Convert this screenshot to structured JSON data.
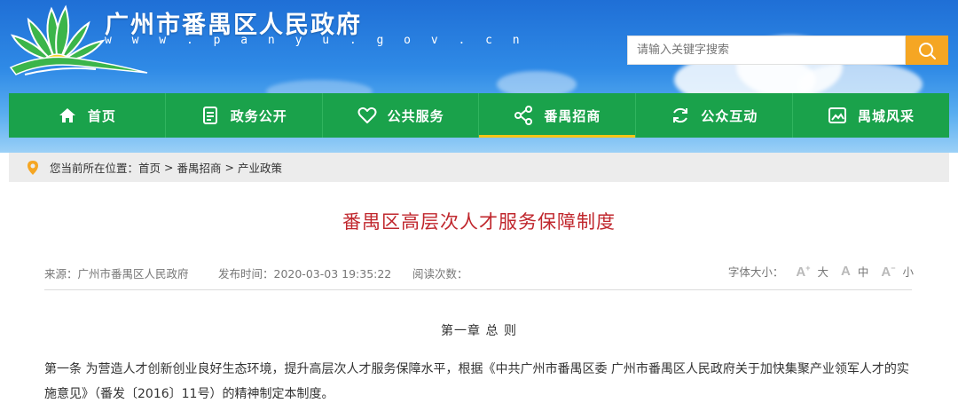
{
  "header": {
    "site_title": "广州市番禺区人民政府",
    "site_url": "w w w . p a n y u . g o v . c n",
    "search_placeholder": "请输入关键字搜索",
    "logo_icon": "lotus-logo-icon",
    "search_icon": "search-icon"
  },
  "nav": {
    "items": [
      {
        "label": "首页",
        "icon": "home-icon"
      },
      {
        "label": "政务公开",
        "icon": "document-icon"
      },
      {
        "label": "公共服务",
        "icon": "heart-icon"
      },
      {
        "label": "番禺招商",
        "icon": "share-icon",
        "active": true
      },
      {
        "label": "公众互动",
        "icon": "refresh-icon"
      },
      {
        "label": "禺城风采",
        "icon": "picture-icon"
      }
    ]
  },
  "breadcrumb": {
    "prefix": "您当前所在位置：",
    "items": [
      "首页",
      "番禺招商",
      "产业政策"
    ],
    "separator": ">",
    "icon": "location-pin-icon"
  },
  "article": {
    "title": "番禺区高层次人才服务保障制度",
    "source": "来源：广州市番禺区人民政府",
    "publish_time": "发布时间：2020-03-03 19:35:22",
    "views": "阅读次数：",
    "font_size_label": "字体大小：",
    "font_sizes": [
      {
        "glyph": "A",
        "mark": "+",
        "label": "大"
      },
      {
        "glyph": "A",
        "mark": "",
        "label": "中"
      },
      {
        "glyph": "A",
        "mark": "−",
        "label": "小"
      }
    ],
    "chapter": "第一章  总 则",
    "paragraph": "第一条  为营造人才创新创业良好生态环境，提升高层次人才服务保障水平，根据《中共广州市番禺区委 广州市番禺区人民政府关于加快集聚产业领军人才的实施意见》（番发〔2016〕11号）的精神制定本制度。"
  },
  "colors": {
    "nav_green": "#1aa24b",
    "nav_active_underline": "#f5c518",
    "title_red": "#c0272d",
    "search_button": "#f5a623",
    "pin_orange": "#f5a623"
  }
}
